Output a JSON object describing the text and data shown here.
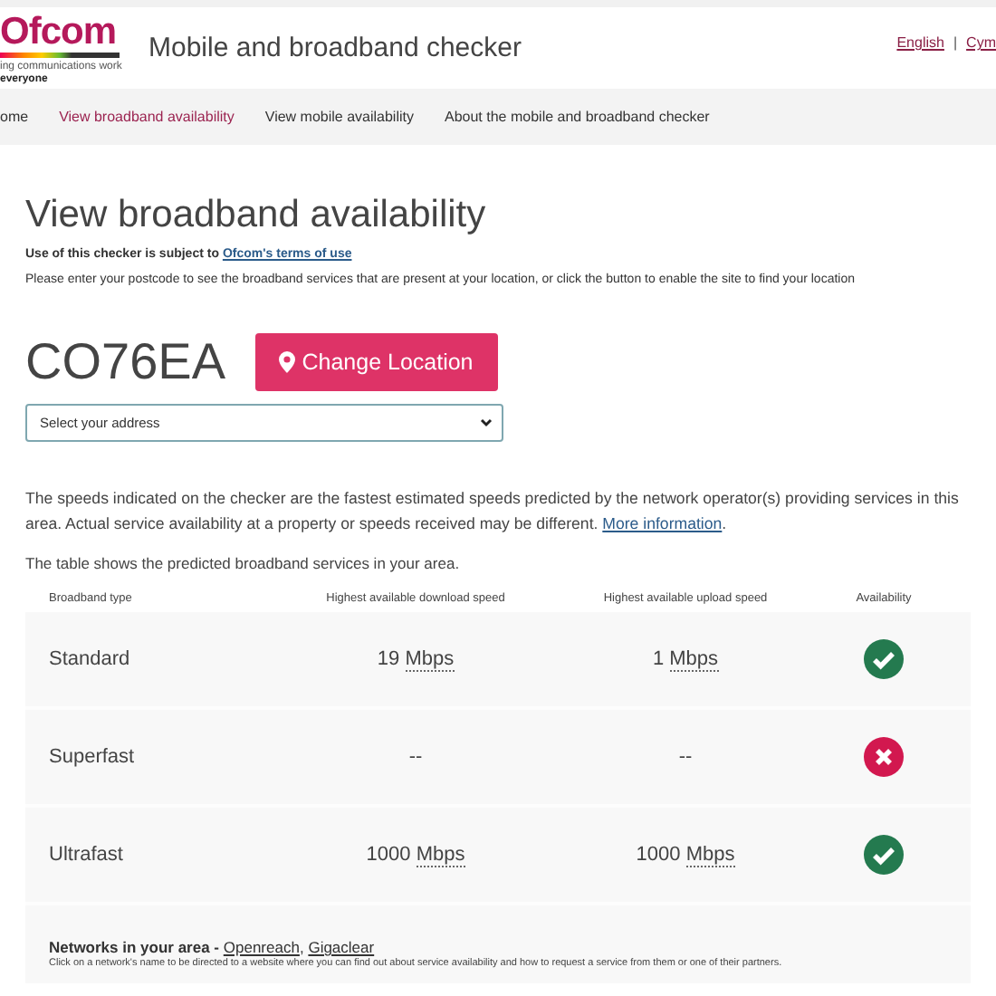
{
  "header": {
    "logo": {
      "wordmark": "Ofcom",
      "tagline": "ing communications work",
      "tagline_2": "everyone"
    },
    "title": "Mobile and broadband checker",
    "languages": [
      "English",
      "Cym"
    ],
    "separator": "|"
  },
  "nav": [
    {
      "label": "ome",
      "selected": false
    },
    {
      "label": "View broadband availability",
      "selected": true
    },
    {
      "label": "View mobile availability",
      "selected": false
    },
    {
      "label": "About the mobile and broadband checker",
      "selected": false
    }
  ],
  "page": {
    "heading": "View broadband availability",
    "terms_text": "Use of this checker is subject to",
    "terms_link": "Ofcom's terms of use",
    "instructions": "Please enter your postcode to see the broadband services that are present at your location, or click the button to enable the site to find your location",
    "postcode": "CO76EA",
    "change_button": "Change Location",
    "address_select": {
      "value": "Select your address"
    },
    "disclaimer": "The speeds indicated on the checker are the fastest estimated speeds predicted by the network operator(s) providing services in this area. Actual service availability at a property or speeds received may be different.",
    "disclaimer_link": "More information",
    "disclaimer_end": ".",
    "table_intro": "The table shows the predicted broadband services in your area."
  },
  "table": {
    "columns": [
      "Broadband type",
      "Highest available download speed",
      "Highest available upload speed",
      "Availability"
    ],
    "rows": [
      {
        "type": "Standard",
        "download": {
          "value": "19",
          "unit": "Mbps"
        },
        "upload": {
          "value": "1",
          "unit": "Mbps"
        },
        "available": true
      },
      {
        "type": "Superfast",
        "download": {
          "value": "--"
        },
        "upload": {
          "value": "--"
        },
        "available": false
      },
      {
        "type": "Ultrafast",
        "download": {
          "value": "1000",
          "unit": "Mbps"
        },
        "upload": {
          "value": "1000",
          "unit": "Mbps"
        },
        "available": true
      }
    ]
  },
  "networks": {
    "label": "Networks in your area -",
    "links": [
      "Openreach",
      "Gigaclear"
    ],
    "link_separator": ",",
    "note": "Click on a network's name to be directed to a website where you can find out about service availability and how to request a service from them or one of their partners."
  }
}
